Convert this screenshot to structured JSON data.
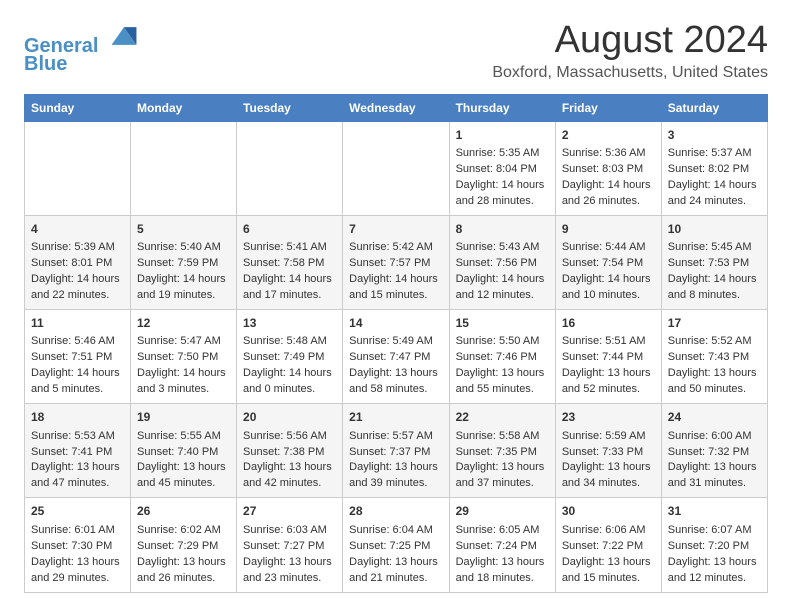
{
  "header": {
    "logo_line1": "General",
    "logo_line2": "Blue",
    "month": "August 2024",
    "location": "Boxford, Massachusetts, United States"
  },
  "days_of_week": [
    "Sunday",
    "Monday",
    "Tuesday",
    "Wednesday",
    "Thursday",
    "Friday",
    "Saturday"
  ],
  "weeks": [
    [
      {
        "day": "",
        "content": ""
      },
      {
        "day": "",
        "content": ""
      },
      {
        "day": "",
        "content": ""
      },
      {
        "day": "",
        "content": ""
      },
      {
        "day": "1",
        "content": "Sunrise: 5:35 AM\nSunset: 8:04 PM\nDaylight: 14 hours\nand 28 minutes."
      },
      {
        "day": "2",
        "content": "Sunrise: 5:36 AM\nSunset: 8:03 PM\nDaylight: 14 hours\nand 26 minutes."
      },
      {
        "day": "3",
        "content": "Sunrise: 5:37 AM\nSunset: 8:02 PM\nDaylight: 14 hours\nand 24 minutes."
      }
    ],
    [
      {
        "day": "4",
        "content": "Sunrise: 5:39 AM\nSunset: 8:01 PM\nDaylight: 14 hours\nand 22 minutes."
      },
      {
        "day": "5",
        "content": "Sunrise: 5:40 AM\nSunset: 7:59 PM\nDaylight: 14 hours\nand 19 minutes."
      },
      {
        "day": "6",
        "content": "Sunrise: 5:41 AM\nSunset: 7:58 PM\nDaylight: 14 hours\nand 17 minutes."
      },
      {
        "day": "7",
        "content": "Sunrise: 5:42 AM\nSunset: 7:57 PM\nDaylight: 14 hours\nand 15 minutes."
      },
      {
        "day": "8",
        "content": "Sunrise: 5:43 AM\nSunset: 7:56 PM\nDaylight: 14 hours\nand 12 minutes."
      },
      {
        "day": "9",
        "content": "Sunrise: 5:44 AM\nSunset: 7:54 PM\nDaylight: 14 hours\nand 10 minutes."
      },
      {
        "day": "10",
        "content": "Sunrise: 5:45 AM\nSunset: 7:53 PM\nDaylight: 14 hours\nand 8 minutes."
      }
    ],
    [
      {
        "day": "11",
        "content": "Sunrise: 5:46 AM\nSunset: 7:51 PM\nDaylight: 14 hours\nand 5 minutes."
      },
      {
        "day": "12",
        "content": "Sunrise: 5:47 AM\nSunset: 7:50 PM\nDaylight: 14 hours\nand 3 minutes."
      },
      {
        "day": "13",
        "content": "Sunrise: 5:48 AM\nSunset: 7:49 PM\nDaylight: 14 hours\nand 0 minutes."
      },
      {
        "day": "14",
        "content": "Sunrise: 5:49 AM\nSunset: 7:47 PM\nDaylight: 13 hours\nand 58 minutes."
      },
      {
        "day": "15",
        "content": "Sunrise: 5:50 AM\nSunset: 7:46 PM\nDaylight: 13 hours\nand 55 minutes."
      },
      {
        "day": "16",
        "content": "Sunrise: 5:51 AM\nSunset: 7:44 PM\nDaylight: 13 hours\nand 52 minutes."
      },
      {
        "day": "17",
        "content": "Sunrise: 5:52 AM\nSunset: 7:43 PM\nDaylight: 13 hours\nand 50 minutes."
      }
    ],
    [
      {
        "day": "18",
        "content": "Sunrise: 5:53 AM\nSunset: 7:41 PM\nDaylight: 13 hours\nand 47 minutes."
      },
      {
        "day": "19",
        "content": "Sunrise: 5:55 AM\nSunset: 7:40 PM\nDaylight: 13 hours\nand 45 minutes."
      },
      {
        "day": "20",
        "content": "Sunrise: 5:56 AM\nSunset: 7:38 PM\nDaylight: 13 hours\nand 42 minutes."
      },
      {
        "day": "21",
        "content": "Sunrise: 5:57 AM\nSunset: 7:37 PM\nDaylight: 13 hours\nand 39 minutes."
      },
      {
        "day": "22",
        "content": "Sunrise: 5:58 AM\nSunset: 7:35 PM\nDaylight: 13 hours\nand 37 minutes."
      },
      {
        "day": "23",
        "content": "Sunrise: 5:59 AM\nSunset: 7:33 PM\nDaylight: 13 hours\nand 34 minutes."
      },
      {
        "day": "24",
        "content": "Sunrise: 6:00 AM\nSunset: 7:32 PM\nDaylight: 13 hours\nand 31 minutes."
      }
    ],
    [
      {
        "day": "25",
        "content": "Sunrise: 6:01 AM\nSunset: 7:30 PM\nDaylight: 13 hours\nand 29 minutes."
      },
      {
        "day": "26",
        "content": "Sunrise: 6:02 AM\nSunset: 7:29 PM\nDaylight: 13 hours\nand 26 minutes."
      },
      {
        "day": "27",
        "content": "Sunrise: 6:03 AM\nSunset: 7:27 PM\nDaylight: 13 hours\nand 23 minutes."
      },
      {
        "day": "28",
        "content": "Sunrise: 6:04 AM\nSunset: 7:25 PM\nDaylight: 13 hours\nand 21 minutes."
      },
      {
        "day": "29",
        "content": "Sunrise: 6:05 AM\nSunset: 7:24 PM\nDaylight: 13 hours\nand 18 minutes."
      },
      {
        "day": "30",
        "content": "Sunrise: 6:06 AM\nSunset: 7:22 PM\nDaylight: 13 hours\nand 15 minutes."
      },
      {
        "day": "31",
        "content": "Sunrise: 6:07 AM\nSunset: 7:20 PM\nDaylight: 13 hours\nand 12 minutes."
      }
    ]
  ]
}
